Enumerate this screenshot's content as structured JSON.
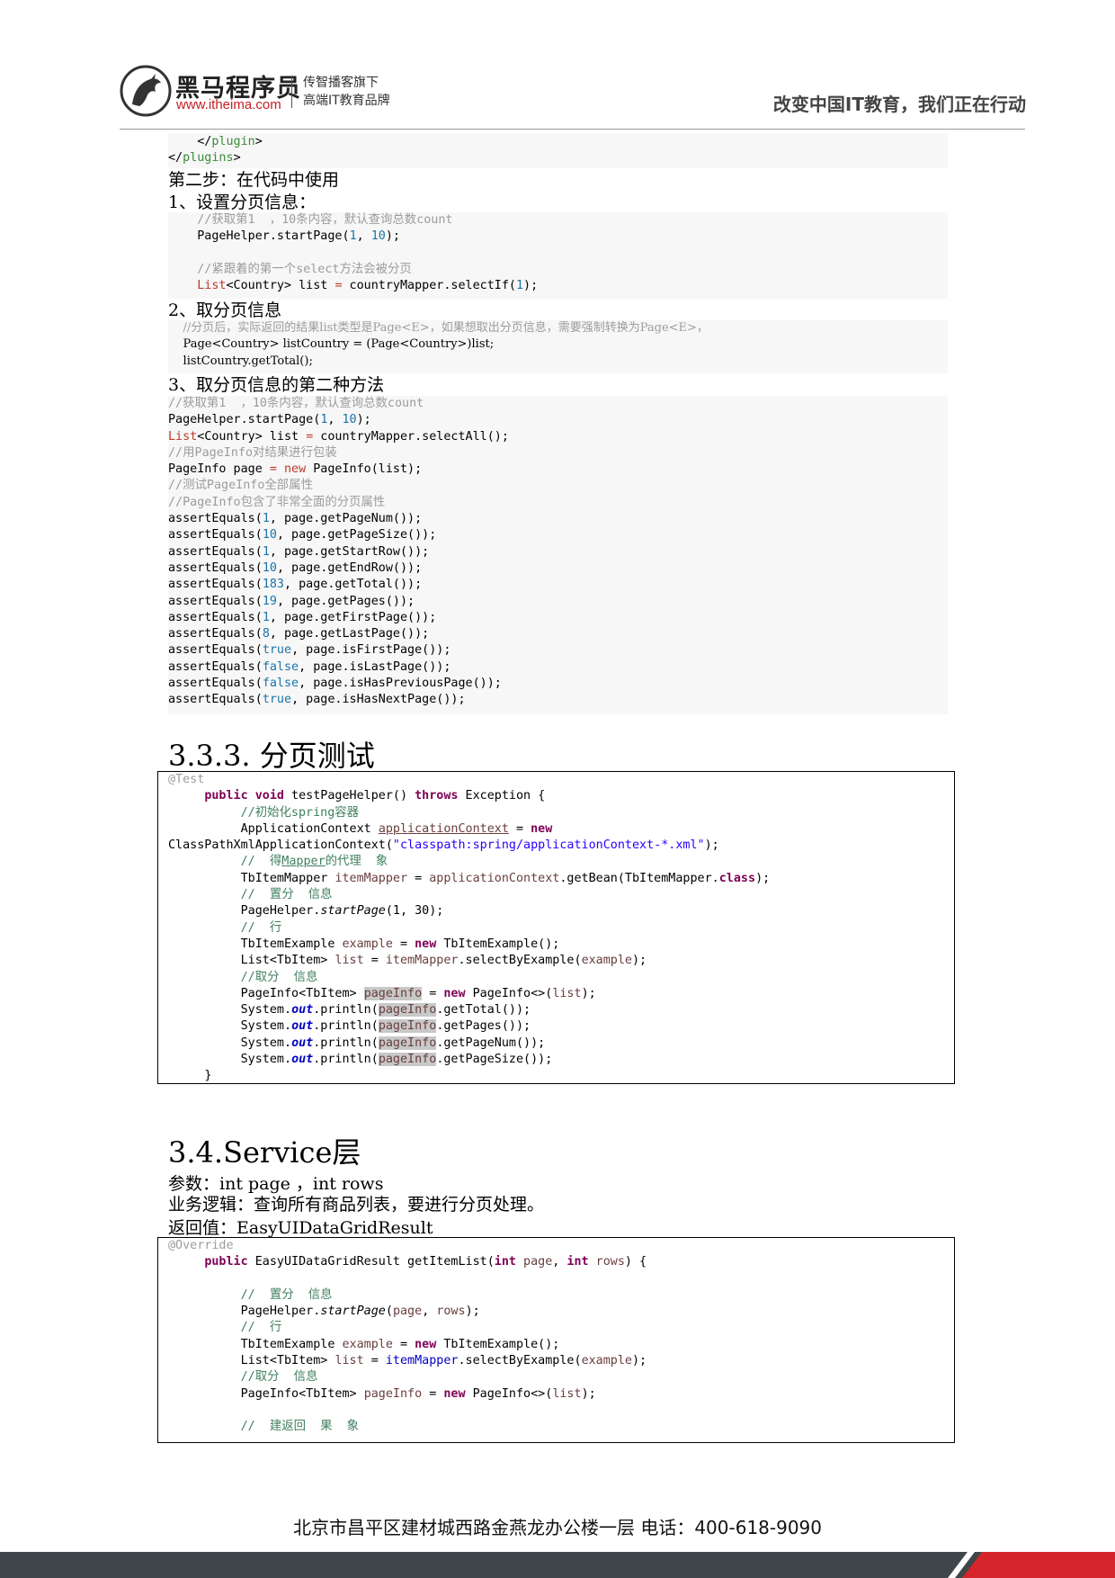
{
  "header": {
    "brand_name": "黑马程序员",
    "brand_url": "www.itheima.com",
    "brand_sub_line1": "传智播客旗下",
    "brand_sub_line2": "高端IT教育品牌",
    "slogan": "改变中国IT教育，我们正在行动"
  },
  "block1": {
    "line1_close": "</",
    "line1_tag": "plugin",
    "line1_end": ">",
    "line2_close": "</",
    "line2_tag": "plugins",
    "line2_end": ">"
  },
  "step2_heading": "第二步：在代码中使用",
  "sub1_heading": "1、设置分页信息：",
  "block2": {
    "comment1": "//获取第1  ，10条内容，默认查询总数count",
    "call1_a": "PageHelper.startPage(",
    "call1_n1": "1",
    "call1_sep": ", ",
    "call1_n2": "10",
    "call1_end": ");",
    "comment2": "//紧跟着的第一个select方法会被分页",
    "list_type": "List",
    "list_gen": "<Country>",
    "list_rest_a": " list ",
    "list_eq": "=",
    "list_rest_b": " countryMapper.selectIf(",
    "list_num": "1",
    "list_end": ");"
  },
  "sub2_heading": "2、取分页信息",
  "block3": {
    "comment": "//分页后，实际返回的结果list类型是Page<E>，如果想取出分页信息，需要强制转换为Page<E>，",
    "line2": "Page<Country> listCountry = (Page<Country>)list;",
    "line3": "listCountry.getTotal();"
  },
  "sub3_heading": "3、取分页信息的第二种方法",
  "block4": {
    "c1": "//获取第1  ，10条内容，默认查询总数count",
    "l2a": "PageHelper.startPage(",
    "l2n1": "1",
    "l2s": ", ",
    "l2n2": "10",
    "l2e": ");",
    "l3t": "List",
    "l3g": "<Country>",
    "l3r": " list ",
    "l3eq": "=",
    "l3e": " countryMapper.selectAll();",
    "c4": "//用PageInfo对结果进行包装",
    "l5a": "PageInfo page ",
    "l5eq": "=",
    "l5sp": " ",
    "l5new": "new",
    "l5e": " PageInfo(list);",
    "c6": "//测试PageInfo全部属性",
    "c7": "//PageInfo包含了非常全面的分页属性",
    "asserts": [
      {
        "v": "1",
        "m": ", page.getPageNum());"
      },
      {
        "v": "10",
        "m": ", page.getPageSize());"
      },
      {
        "v": "1",
        "m": ", page.getStartRow());"
      },
      {
        "v": "10",
        "m": ", page.getEndRow());"
      },
      {
        "v": "183",
        "m": ", page.getTotal());"
      },
      {
        "v": "19",
        "m": ", page.getPages());"
      },
      {
        "v": "1",
        "m": ", page.getFirstPage());"
      },
      {
        "v": "8",
        "m": ", page.getLastPage());"
      },
      {
        "v": "true",
        "m": ", page.isFirstPage());"
      },
      {
        "v": "false",
        "m": ", page.isLastPage());"
      },
      {
        "v": "false",
        "m": ", page.isHasPreviousPage());"
      },
      {
        "v": "true",
        "m": ", page.isHasNextPage());"
      }
    ],
    "assert_fn": "assertEquals("
  },
  "section_333": "3.3.3. 分页测试",
  "block5": {
    "annot": "@Test",
    "sig_public": "public",
    "sig_void": "void",
    "sig_name": " testPageHelper() ",
    "sig_throws": "throws",
    "sig_rest": " Exception {",
    "c_init": "//初始化spring容器",
    "ac_type": "ApplicationContext ",
    "ac_var": "applicationContext",
    "ac_eq": " = ",
    "ac_new": "new",
    "ac2_cls": "ClassPathXmlApplicationContext(",
    "ac2_str": "\"classpath:spring/applicationContext-*.xml\"",
    "ac2_end": ");",
    "c_proxy_a": "//  得",
    "c_proxy_mapper": "Mapper",
    "c_proxy_b": "的代理  象",
    "bean_type": "TbItemMapper ",
    "bean_var": "itemMapper",
    "bean_eq": " = ",
    "bean_ctx": "applicationContext",
    "bean_call": ".getBean(TbItemMapper.",
    "bean_class": "class",
    "bean_end": ");",
    "c_set": "//  置分  信息",
    "ph_a": "PageHelper.",
    "ph_m": "startPage",
    "ph_args": "(1, 30);",
    "c_exec": "//  行",
    "ex_type": "TbItemExample ",
    "ex_var": "example",
    "ex_eq": " = ",
    "ex_new": "new",
    "ex_end": " TbItemExample();",
    "li_type": "List<TbItem> ",
    "li_var": "list",
    "li_eq": " = ",
    "li_mapper": "itemMapper",
    "li_call": ".selectByExample(",
    "li_arg": "example",
    "li_end": ");",
    "c_get": "//取分  信息",
    "pi_type": "PageInfo<TbItem> ",
    "pi_var": "pageInfo",
    "pi_eq": " = ",
    "pi_new": "new",
    "pi_cls": " PageInfo<>(",
    "pi_arg": "list",
    "pi_end": ");",
    "sys": "System.",
    "out": "out",
    "println": ".println(",
    "pv": "pageInfo",
    "prints": [
      ".getTotal());",
      ".getPages());",
      ".getPageNum());",
      ".getPageSize());"
    ],
    "close": "}"
  },
  "section_34": "3.4.Service层",
  "service": {
    "params": "参数：int page ，int rows",
    "logic": "业务逻辑：查询所有商品列表，要进行分页处理。",
    "ret": "返回值：EasyUIDataGridResult"
  },
  "block6": {
    "annot": "@Override",
    "s_public": "public",
    "s_ret": " EasyUIDataGridResult getItemList(",
    "s_int1": "int",
    "s_p1": " page",
    "s_sep": ", ",
    "s_int2": "int",
    "s_p2": " rows",
    "s_end": ") {",
    "c_set": "//  置分  信息",
    "ph_a": "PageHelper.",
    "ph_m": "startPage",
    "ph_o": "(",
    "ph_p": "page",
    "ph_s": ", ",
    "ph_r": "rows",
    "ph_e": ");",
    "c_exec": "//  行",
    "ex_type": "TbItemExample ",
    "ex_var": "example",
    "ex_eq": " = ",
    "ex_new": "new",
    "ex_end": " TbItemExample();",
    "li_type": "List<TbItem> ",
    "li_var": "list",
    "li_eq": " = ",
    "li_mapper": "itemMapper",
    "li_call": ".selectByExample(",
    "li_arg": "example",
    "li_end": ");",
    "c_get": "//取分  信息",
    "pi_type": "PageInfo<TbItem> ",
    "pi_var": "pageInfo",
    "pi_eq": " = ",
    "pi_new": "new",
    "pi_cls": " PageInfo<>(",
    "pi_arg": "list",
    "pi_end": ");",
    "c_build": "//  建返回  果  象"
  },
  "footer": {
    "text": "北京市昌平区建材城西路金燕龙办公楼一层   电话：400-618-9090"
  },
  "colors": {
    "brand_red": "#c41e24",
    "footer_bar": "#3f4649",
    "footer_accent": "#d5242b"
  }
}
